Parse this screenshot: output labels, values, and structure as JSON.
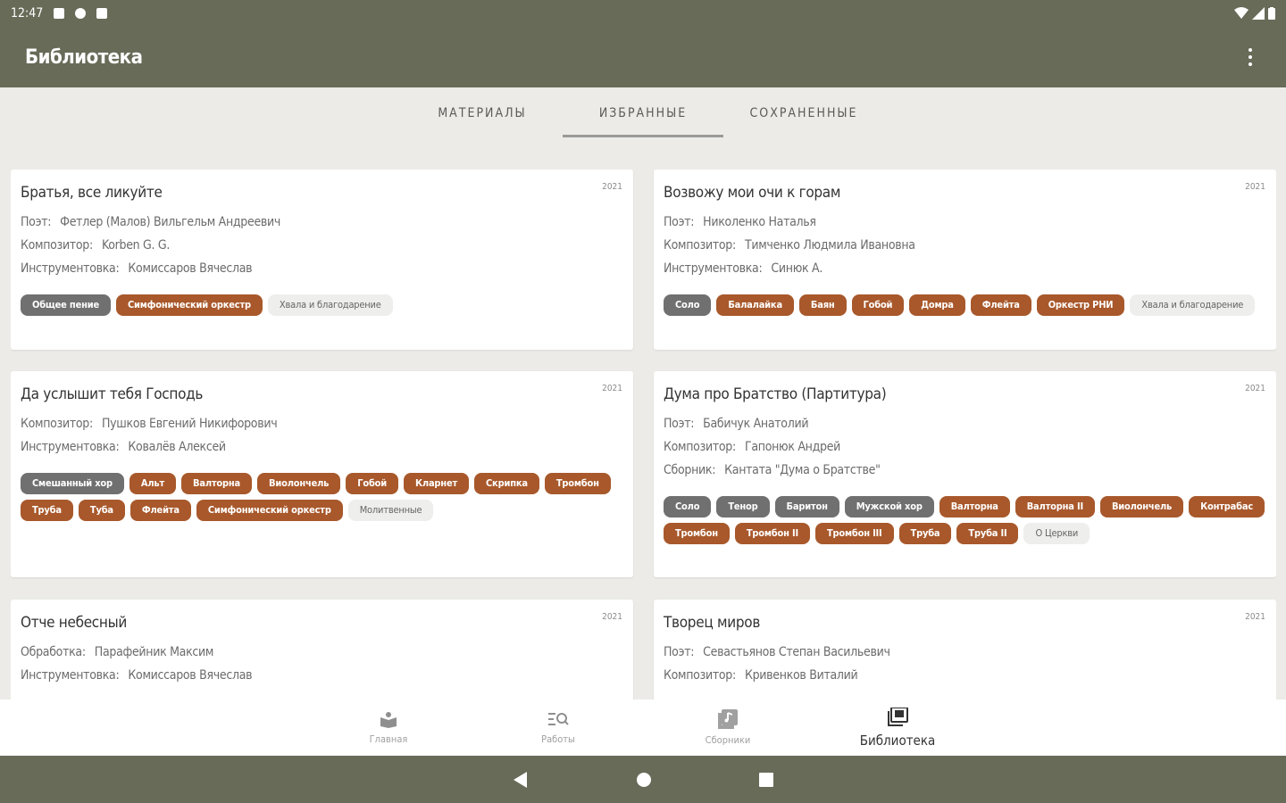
{
  "status": {
    "time": "12:47"
  },
  "app": {
    "title": "Библиотека"
  },
  "tabs": [
    {
      "label": "МАТЕРИАЛЫ",
      "active": false
    },
    {
      "label": "ИЗБРАННЫЕ",
      "active": true
    },
    {
      "label": "СОХРАНЕННЫЕ",
      "active": false
    }
  ],
  "cards": [
    {
      "title": "Братья, все ликуйте",
      "year": "2021",
      "rows": [
        {
          "label": "Поэт:",
          "value": "Фетлер (Малов) Вильгельм Андреевич"
        },
        {
          "label": "Композитор:",
          "value": "Korben G. G."
        },
        {
          "label": "Инструментовка:",
          "value": "Комиссаров Вячеслав"
        }
      ],
      "chips": [
        {
          "label": "Общее пение",
          "kind": "gray"
        },
        {
          "label": "Симфонический оркестр",
          "kind": "brown"
        },
        {
          "label": "Хвала и благодарение",
          "kind": "light"
        }
      ]
    },
    {
      "title": "Возвожу мои очи к горам",
      "year": "2021",
      "rows": [
        {
          "label": "Поэт:",
          "value": "Николенко Наталья"
        },
        {
          "label": "Композитор:",
          "value": "Тимченко Людмила Ивановна"
        },
        {
          "label": "Инструментовка:",
          "value": "Синюк А."
        }
      ],
      "chips": [
        {
          "label": "Соло",
          "kind": "gray"
        },
        {
          "label": "Балалайка",
          "kind": "brown"
        },
        {
          "label": "Баян",
          "kind": "brown"
        },
        {
          "label": "Гобой",
          "kind": "brown"
        },
        {
          "label": "Домра",
          "kind": "brown"
        },
        {
          "label": "Флейта",
          "kind": "brown"
        },
        {
          "label": "Оркестр РНИ",
          "kind": "brown"
        },
        {
          "label": "Хвала и благодарение",
          "kind": "light"
        }
      ]
    },
    {
      "title": "Да услышит тебя Господь",
      "year": "2021",
      "rows": [
        {
          "label": "Композитор:",
          "value": "Пушков Евгений Никифорович"
        },
        {
          "label": "Инструментовка:",
          "value": "Ковалёв Алексей"
        }
      ],
      "chips": [
        {
          "label": "Смешанный хор",
          "kind": "gray"
        },
        {
          "label": "Альт",
          "kind": "brown"
        },
        {
          "label": "Валторна",
          "kind": "brown"
        },
        {
          "label": "Виолончель",
          "kind": "brown"
        },
        {
          "label": "Гобой",
          "kind": "brown"
        },
        {
          "label": "Кларнет",
          "kind": "brown"
        },
        {
          "label": "Скрипка",
          "kind": "brown"
        },
        {
          "label": "Тромбон",
          "kind": "brown"
        },
        {
          "label": "Труба",
          "kind": "brown"
        },
        {
          "label": "Туба",
          "kind": "brown"
        },
        {
          "label": "Флейта",
          "kind": "brown"
        },
        {
          "label": "Симфонический оркестр",
          "kind": "brown"
        },
        {
          "label": "Молитвенные",
          "kind": "light"
        }
      ]
    },
    {
      "title": "Дума про Братство (Партитура)",
      "year": "2021",
      "rows": [
        {
          "label": "Поэт:",
          "value": "Бабичук Анатолий"
        },
        {
          "label": "Композитор:",
          "value": "Гапонюк Андрей"
        },
        {
          "label": "Сборник:",
          "value": "Кантата \"Дума о Братстве\""
        }
      ],
      "chips": [
        {
          "label": "Соло",
          "kind": "gray"
        },
        {
          "label": "Тенор",
          "kind": "gray"
        },
        {
          "label": "Баритон",
          "kind": "gray"
        },
        {
          "label": "Мужской хор",
          "kind": "gray"
        },
        {
          "label": "Валторна",
          "kind": "brown"
        },
        {
          "label": "Валторна II",
          "kind": "brown"
        },
        {
          "label": "Виолончель",
          "kind": "brown"
        },
        {
          "label": "Контрабас",
          "kind": "brown"
        },
        {
          "label": "Тромбон",
          "kind": "brown"
        },
        {
          "label": "Тромбон II",
          "kind": "brown"
        },
        {
          "label": "Тромбон III",
          "kind": "brown"
        },
        {
          "label": "Труба",
          "kind": "brown"
        },
        {
          "label": "Труба II",
          "kind": "brown"
        },
        {
          "label": "О Церкви",
          "kind": "light"
        }
      ]
    },
    {
      "title": "Отче небесный",
      "year": "2021",
      "rows": [
        {
          "label": "Обработка:",
          "value": "Парафейник Максим"
        },
        {
          "label": "Инструментовка:",
          "value": "Комиссаров Вячеслав"
        }
      ],
      "chips": []
    },
    {
      "title": "Творец миров",
      "year": "2021",
      "rows": [
        {
          "label": "Поэт:",
          "value": "Севастьянов Степан Васильевич"
        },
        {
          "label": "Композитор:",
          "value": "Кривенков Виталий"
        }
      ],
      "chips": []
    }
  ],
  "bottom_nav": [
    {
      "label": "Главная",
      "icon": "home-book-icon",
      "active": false
    },
    {
      "label": "Работы",
      "icon": "search-list-icon",
      "active": false
    },
    {
      "label": "Сборники",
      "icon": "collection-icon",
      "active": false
    },
    {
      "label": "Библиотека",
      "icon": "library-icon",
      "active": true
    }
  ],
  "colors": {
    "primary": "#676b58",
    "chip_brown": "#a8582b",
    "chip_gray": "#707070",
    "background": "#ecebe7"
  }
}
